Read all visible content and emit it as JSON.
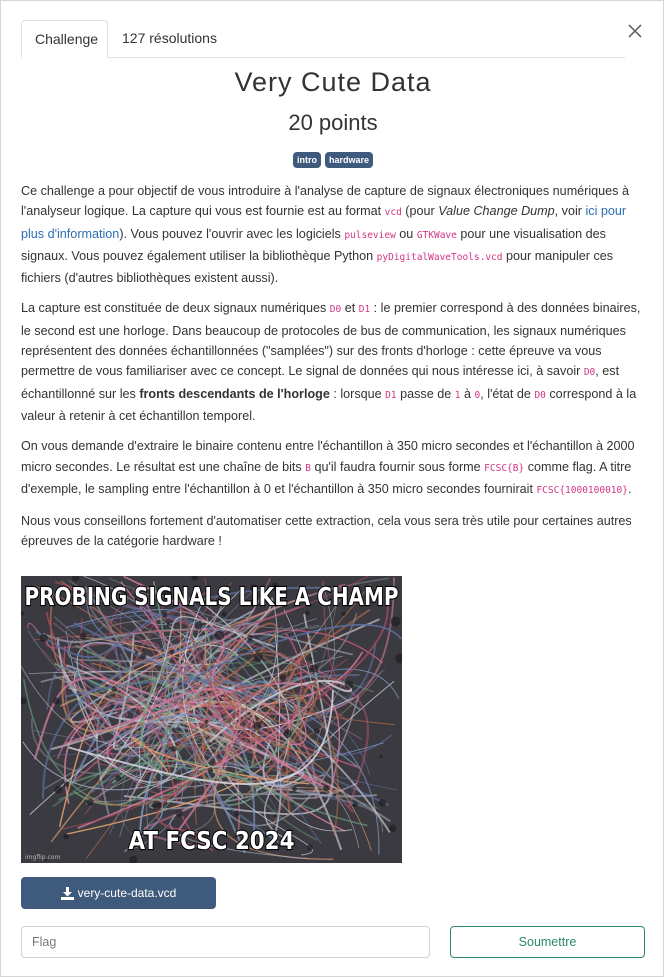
{
  "tabs": {
    "challenge": "Challenge",
    "solves": "127 résolutions"
  },
  "challenge": {
    "title": "Very Cute Data",
    "points": "20 points",
    "tags": [
      "intro",
      "hardware"
    ]
  },
  "description": {
    "p1": {
      "t1": "Ce challenge a pour objectif de vous introduire à l'analyse de capture de signaux électroniques numériques à l'analyseur logique. La capture qui vous est fournie est au format ",
      "c1": "vcd",
      "t2": " (pour ",
      "em": "Value Change Dump",
      "t3": ", voir ",
      "link": "ici pour plus d'information",
      "t4": "). Vous pouvez l'ouvrir avec les logiciels ",
      "c2": "pulseview",
      "t5": " ou ",
      "c3": "GTKWave",
      "t6": " pour une visualisation des signaux. Vous pouvez également utiliser la bibliothèque Python ",
      "c4": "pyDigitalWaveTools.vcd",
      "t7": " pour manipuler ces fichiers (d'autres bibliothèques existent aussi)."
    },
    "p2": {
      "t1": "La capture est constituée de deux signaux numériques ",
      "c1": "D0",
      "t2": " et ",
      "c2": "D1",
      "t3": " : le premier correspond à des données binaires, le second est une horloge. Dans beaucoup de protocoles de bus de communication, les signaux numériques représentent des données échantillonnées (\"samplées\") sur des fronts d'horloge : cette épreuve va vous permettre de vous familiariser avec ce concept. Le signal de données qui nous intéresse ici, à savoir ",
      "c3": "D0",
      "t4": ", est échantillonné sur les ",
      "strong": "fronts descendants de l'horloge",
      "t5": " : lorsque ",
      "c4": "D1",
      "t6": " passe de ",
      "c5": "1",
      "t7": " à ",
      "c6": "0",
      "t8": ", l'état de ",
      "c7": "D0",
      "t9": " correspond à la valeur à retenir à cet échantillon temporel."
    },
    "p3": {
      "t1": "On vous demande d'extraire le binaire contenu entre l'échantillon à 350 micro secondes et l'échantillon à 2000 micro secondes. Le résultat est une chaîne de bits ",
      "c1": "B",
      "t2": " qu'il faudra fournir sous forme ",
      "c2": "FCSC{B}",
      "t3": " comme flag. A titre d'exemple, le sampling entre l'échantillon à 0 et l'échantillon à 350 micro secondes fournirait ",
      "c3": "FCSC{1000100010}",
      "t4": "."
    },
    "p4": "Nous vous conseillons fortement d'automatiser cette extraction, cela vous sera très utile pour certaines autres épreuves de la catégorie hardware !"
  },
  "meme": {
    "top": "PROBING SIGNALS LIKE A CHAMP",
    "bottom": "AT FCSC 2024",
    "watermark": "imgflip.com"
  },
  "download": {
    "label": "very-cute-data.vcd"
  },
  "flag": {
    "placeholder": "Flag",
    "value": ""
  },
  "submit": {
    "label": "Soumettre"
  },
  "colors": {
    "accent": "#3e5a7c",
    "success": "#2b8a65",
    "code": "#d63384",
    "link": "#2c6fb3"
  }
}
